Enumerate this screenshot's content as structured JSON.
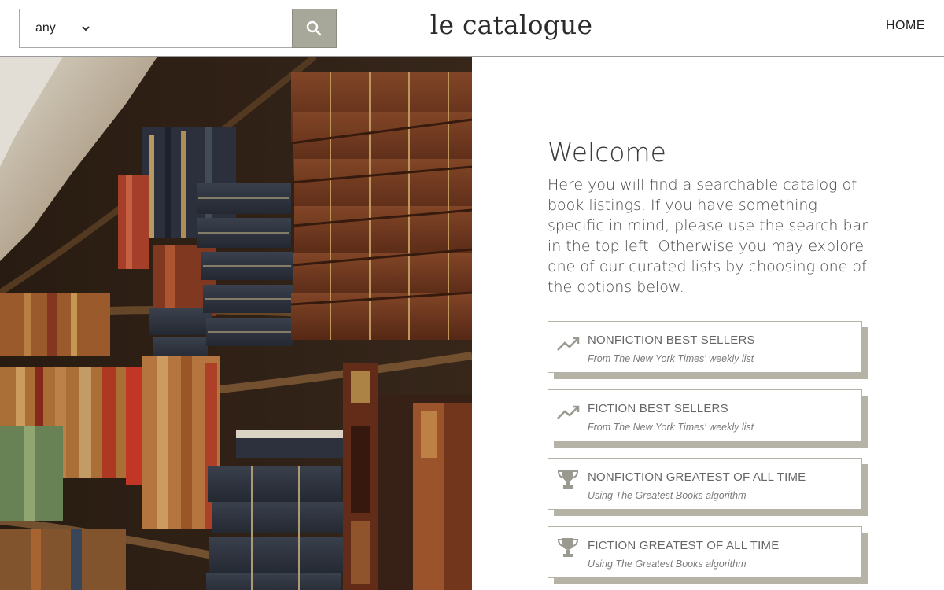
{
  "header": {
    "search": {
      "category_value": "any",
      "placeholder": ""
    },
    "brand": "le catalogue",
    "nav": {
      "home_label": "HOME"
    }
  },
  "main": {
    "welcome_title": "Welcome",
    "intro": "Here you will find a searchable catalog of book listings. If you have something specific in mind, please use the search bar in the top left. Otherwise you may explore one of our curated lists by choosing one of the options below.",
    "lists": [
      {
        "title": "NONFICTION BEST SELLERS",
        "subtitle": "From The New York Times' weekly list",
        "icon": "trending-up-icon"
      },
      {
        "title": "FICTION BEST SELLERS",
        "subtitle": "From The New York Times' weekly list",
        "icon": "trending-up-icon"
      },
      {
        "title": "NONFICTION GREATEST OF ALL TIME",
        "subtitle": "Using The Greatest Books algorithm",
        "icon": "trophy-icon"
      },
      {
        "title": "FICTION GREATEST OF ALL TIME",
        "subtitle": "Using The Greatest Books algorithm",
        "icon": "trophy-icon"
      }
    ]
  },
  "colors": {
    "accent": "#a8a89a",
    "card_shadow": "#b5b3a5",
    "text": "#4a4a4a"
  }
}
